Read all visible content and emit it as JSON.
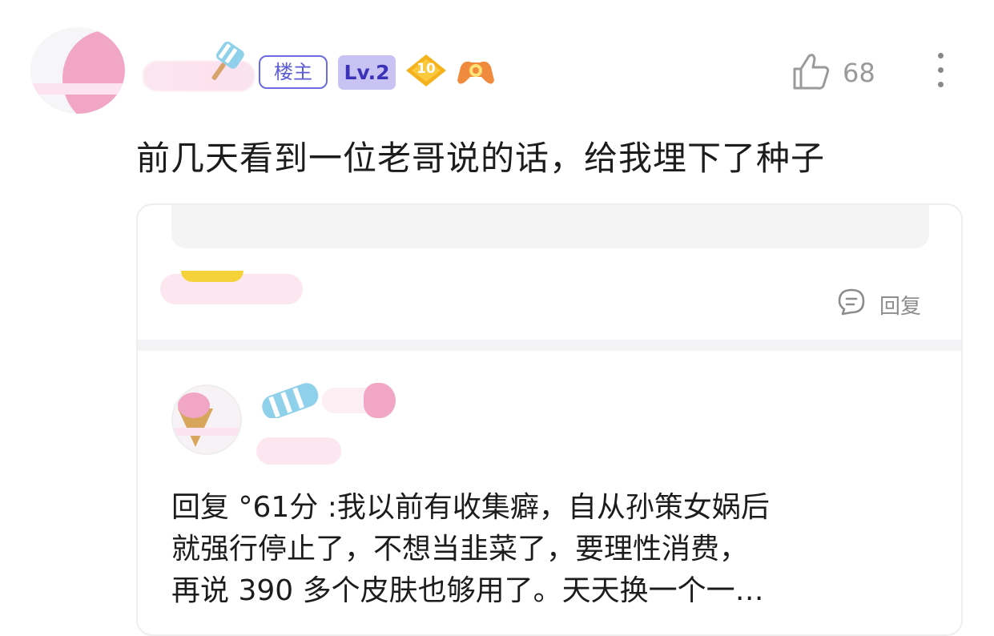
{
  "post": {
    "author_tag": "楼主",
    "level_badge": "Lv.2",
    "fan_badge_number": "10",
    "like_count": "68",
    "text": "前几天看到一位老哥说的话，给我埋下了种子"
  },
  "quoted_card": {
    "reply_label": "回复",
    "reply_text": "回复  °61分 :我以前有收集癖，自从孙策女娲后\n就强行停止了，不想当韭菜了，要理性消费，\n再说 390 多个皮肤也够用了。天天换一个一…"
  },
  "colors": {
    "accent_purple": "#5b5bd6",
    "level_bg": "#c9c3f3",
    "muted_gray": "#9a9a9a"
  },
  "icons": [
    "thumbs-up-icon",
    "more-vertical-icon",
    "comment-icon",
    "gamepad-icon",
    "fan-level-badge"
  ]
}
